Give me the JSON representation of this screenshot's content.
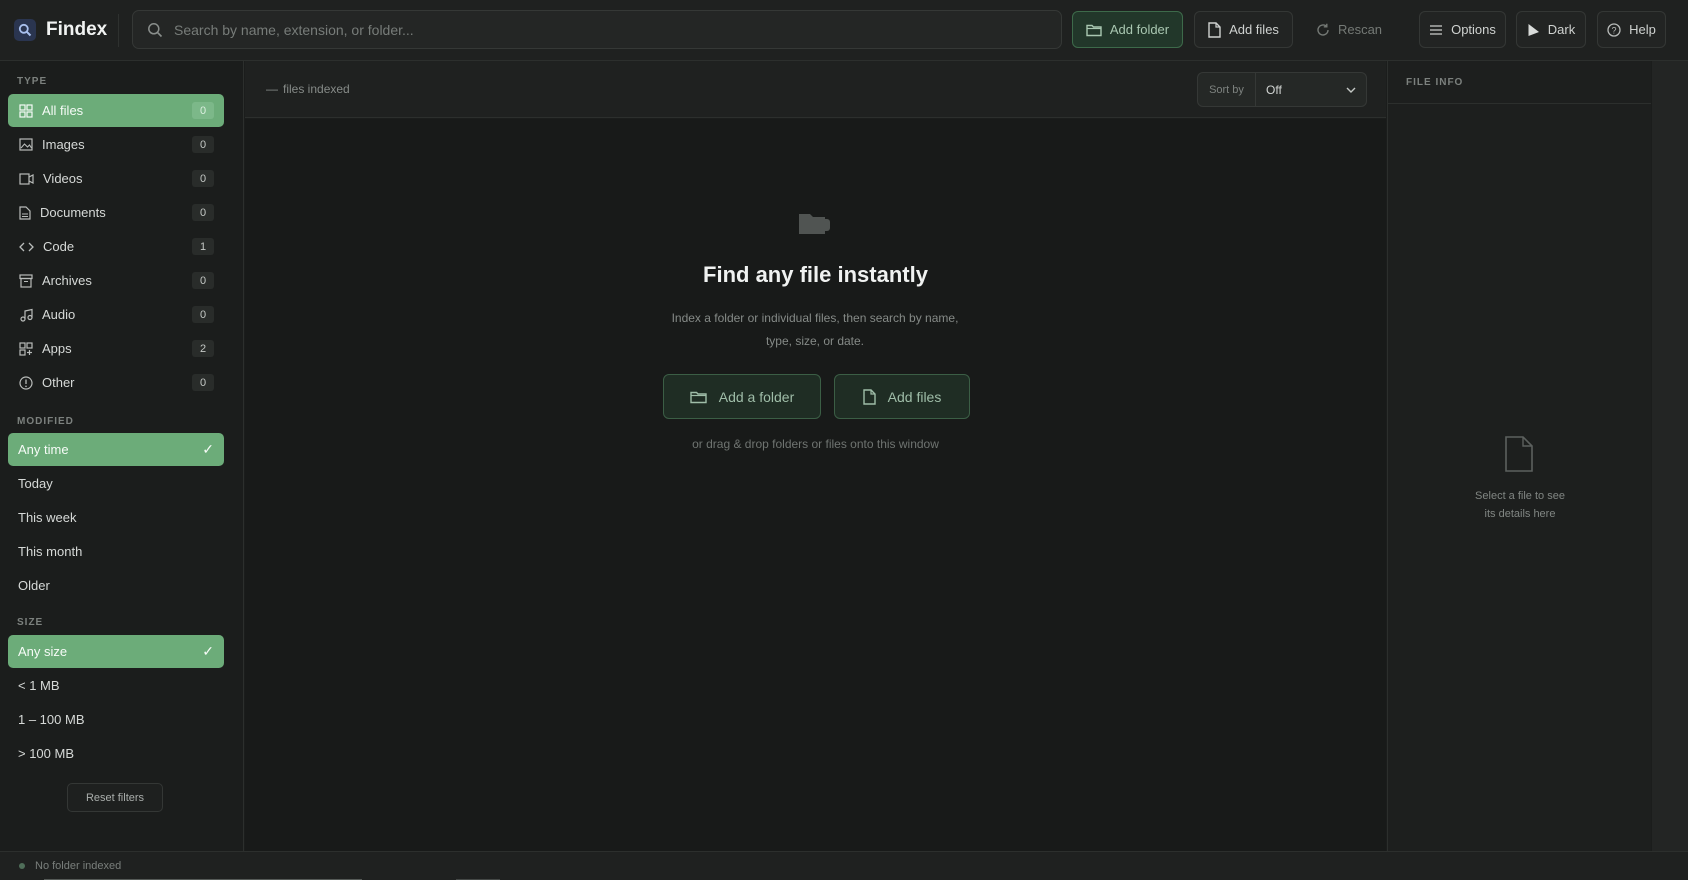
{
  "app": {
    "name": "Findex"
  },
  "search": {
    "placeholder": "Search by name, extension, or folder..."
  },
  "toolbar": {
    "add_folder": "Add folder",
    "add_files": "Add files",
    "rescan": "Rescan",
    "options": "Options",
    "theme": "Dark",
    "help": "Help"
  },
  "sidebar": {
    "type_title": "TYPE",
    "types": [
      {
        "label": "All files",
        "count": "0",
        "icon": "grid-icon"
      },
      {
        "label": "Images",
        "count": "0",
        "icon": "image-icon"
      },
      {
        "label": "Videos",
        "count": "0",
        "icon": "video-icon"
      },
      {
        "label": "Documents",
        "count": "0",
        "icon": "document-icon"
      },
      {
        "label": "Code",
        "count": "1",
        "icon": "code-icon"
      },
      {
        "label": "Archives",
        "count": "0",
        "icon": "archive-icon"
      },
      {
        "label": "Audio",
        "count": "0",
        "icon": "audio-icon"
      },
      {
        "label": "Apps",
        "count": "2",
        "icon": "apps-icon"
      },
      {
        "label": "Other",
        "count": "0",
        "icon": "info-icon"
      }
    ],
    "modified_title": "MODIFIED",
    "modified": [
      "Any time",
      "Today",
      "This week",
      "This month",
      "Older"
    ],
    "size_title": "SIZE",
    "sizes": [
      "Any size",
      "< 1 MB",
      "1 – 100 MB",
      "> 100 MB"
    ],
    "reset": "Reset filters"
  },
  "main": {
    "count_prefix": "—",
    "count_label": "files indexed",
    "sort_label": "Sort by",
    "sort_value": "Off",
    "hero_title": "Find any file instantly",
    "hero_sub": "Index a folder or individual files, then search by name, type, size, or date.",
    "btn_folder": "Add a folder",
    "btn_files": "Add files",
    "hint": "or drag & drop folders or files onto this window"
  },
  "info": {
    "title": "FILE INFO",
    "empty_line1": "Select a file to see",
    "empty_line2": "its details here"
  },
  "status": {
    "text": "No folder indexed"
  },
  "colors": {
    "accent": "#6cac79",
    "background": "#1b1d1c"
  }
}
